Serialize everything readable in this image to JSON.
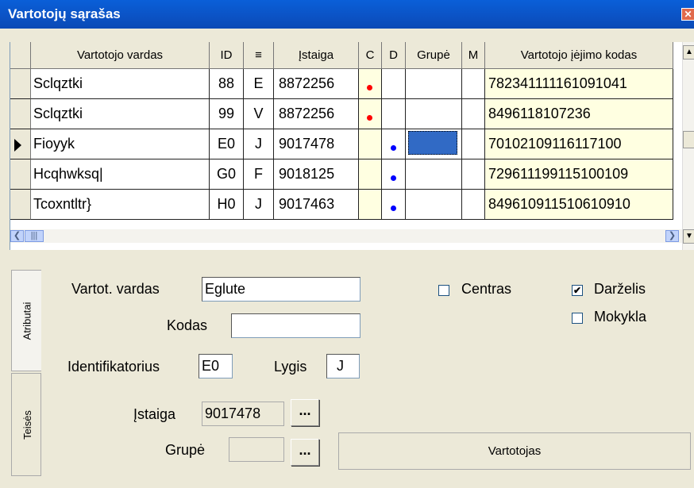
{
  "window": {
    "title": "Vartotojų sąrašas",
    "close_symbol": "✕"
  },
  "grid": {
    "headers": {
      "name": "Vartotojo vardas",
      "id": "ID",
      "eq": "≡",
      "istaiga": "Įstaiga",
      "c": "C",
      "d": "D",
      "grupe": "Grupė",
      "m": "M",
      "code": "Vartotojo įėjimo kodas"
    },
    "rows": [
      {
        "name": "Sclqztki",
        "id": "88",
        "eq": "E",
        "istaiga": "8872256",
        "c_dot": "red",
        "d_dot": "",
        "code": "782341111161091041"
      },
      {
        "name": "Sclqztki",
        "id": "99",
        "eq": "V",
        "istaiga": "8872256",
        "c_dot": "red",
        "d_dot": "",
        "code": "8496118107236"
      },
      {
        "name": "Fioyyk",
        "id": "E0",
        "eq": "J",
        "istaiga": "9017478",
        "c_dot": "",
        "d_dot": "blue",
        "code": "70102109116117100"
      },
      {
        "name": "Hcqhwksq|",
        "id": "G0",
        "eq": "F",
        "istaiga": "9018125",
        "c_dot": "",
        "d_dot": "blue",
        "code": "729611199115100109"
      },
      {
        "name": "Tcoxntltr}",
        "id": "H0",
        "eq": "J",
        "istaiga": "9017463",
        "c_dot": "",
        "d_dot": "blue",
        "code": "849610911510610910"
      }
    ],
    "selected_row": 2
  },
  "tabs": {
    "attributes": "Atributai",
    "rights": "Teisės"
  },
  "form": {
    "username_label": "Vartot. vardas",
    "username_value": "Eglute",
    "code_label": "Kodas",
    "code_value": "",
    "identifier_label": "Identifikatorius",
    "identifier_value": "E0",
    "level_label": "Lygis",
    "level_value": "J",
    "istaiga_label": "Įstaiga",
    "istaiga_value": "9017478",
    "group_label": "Grupė",
    "group_value": "",
    "browse_label": "...",
    "role_value": "Vartotojas",
    "centras_label": "Centras",
    "centras_checked": false,
    "darzelis_label": "Darželis",
    "darzelis_checked": true,
    "mokykla_label": "Mokykla",
    "mokykla_checked": false
  },
  "colors": {
    "title_bar": "#0b55c8",
    "selection": "#316ac5",
    "code_column_bg": "#ffffe1",
    "red_dot": "#ff0000",
    "blue_dot": "#0000ff"
  }
}
